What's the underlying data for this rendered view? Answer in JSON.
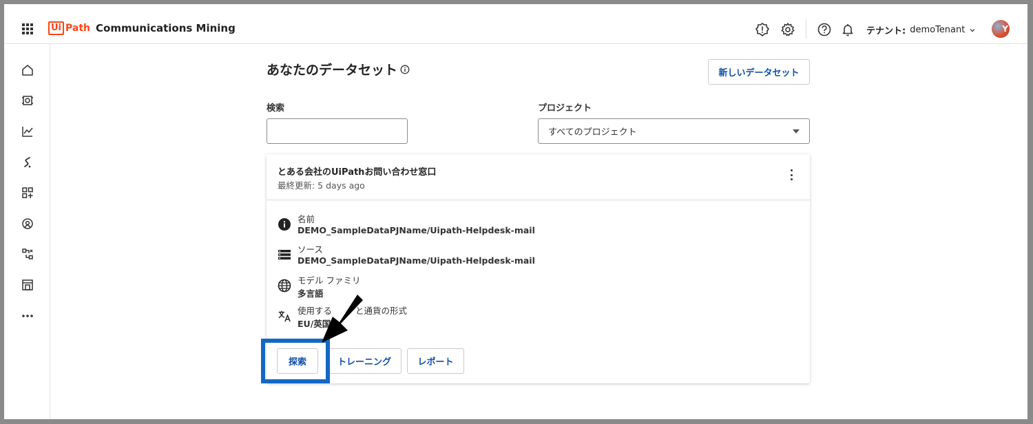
{
  "header": {
    "logo_ui": "Ui",
    "logo_path": "Path",
    "app_name": "Communications Mining",
    "tenant_label": "テナント:",
    "tenant_value": "demoTenant",
    "avatar_initial": "Y"
  },
  "page": {
    "title": "あなたのデータセット",
    "new_dataset_button": "新しいデータセット"
  },
  "filters": {
    "search_label": "検索",
    "search_value": "",
    "project_label": "プロジェクト",
    "project_value": "すべてのプロジェクト"
  },
  "dataset_card": {
    "title": "とある会社のUiPathお問い合わせ窓口",
    "updated": "最終更新: 5 days ago",
    "name_label": "名前",
    "name_value": "DEMO_SampleDataPJName/Uipath-Helpdesk-mail",
    "source_label": "ソース",
    "source_value": "DEMO_SampleDataPJName/Uipath-Helpdesk-mail",
    "model_label": "モデル ファミリ",
    "model_value": "多言語",
    "format_label": "使用する",
    "format_label_rest": "と通貨の形式",
    "format_value": "EU/英国",
    "buttons": {
      "explore": "探索",
      "train": "トレーニング",
      "report": "レポート"
    }
  },
  "colors": {
    "brand": "#fa4616",
    "link_blue": "#0f4fa8",
    "highlight": "#1368c4"
  },
  "icons": [
    "apps-grid-icon",
    "alert-icon",
    "gear-icon",
    "help-icon",
    "bell-icon",
    "chevron-down-icon",
    "home-icon",
    "dataset-icon",
    "chart-icon",
    "stream-icon",
    "add-widget-icon",
    "location-icon",
    "integration-icon",
    "store-icon",
    "more-icon",
    "info-icon",
    "database-icon",
    "globe-icon",
    "translate-icon",
    "kebab-icon",
    "arrow-pointer-icon"
  ]
}
